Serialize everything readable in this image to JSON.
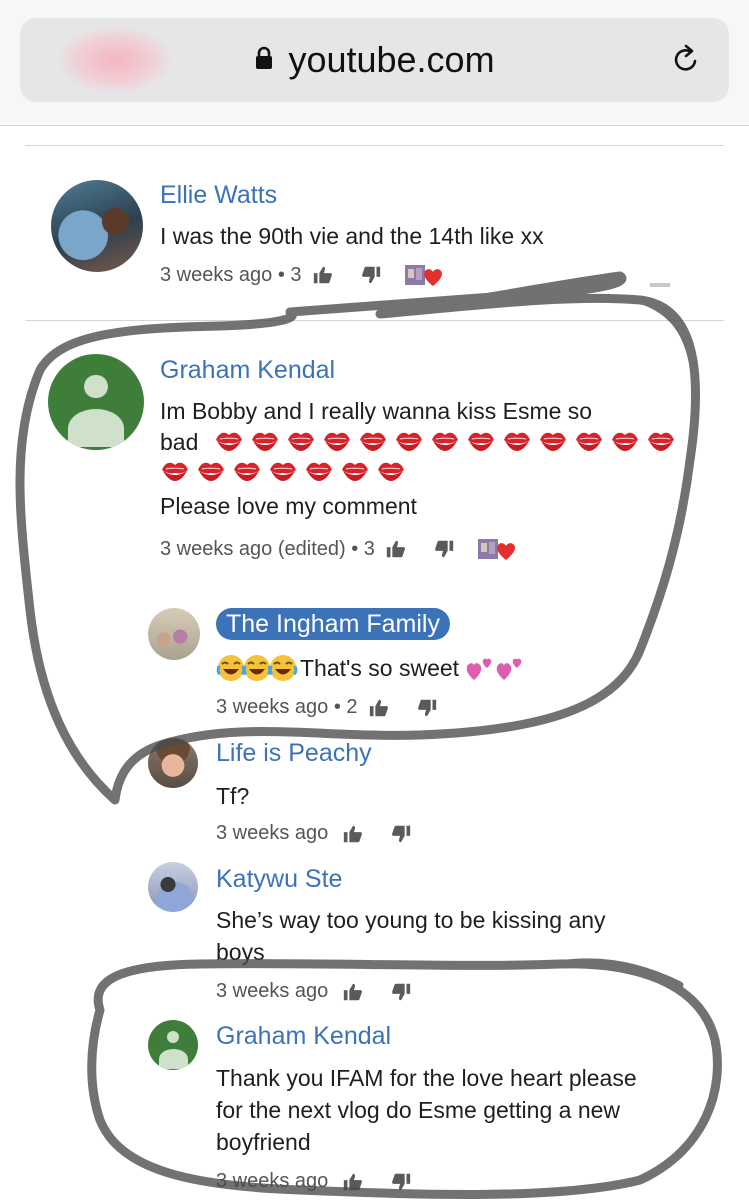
{
  "browser": {
    "url": "youtube.com"
  },
  "colors": {
    "link_blue": "#3b72b8",
    "default_avatar_green": "#3f7d3a",
    "heart_red": "#e3302f",
    "kiss_red": "#d8232a",
    "pink_hearts": "#e05cb0"
  },
  "comments": [
    {
      "author": "Ellie Watts",
      "text": "I was the 90th vie and the 14th like xx",
      "time": "3 weeks ago",
      "likes": "3",
      "creator_heart": true
    },
    {
      "author": "Graham Kendal",
      "text_line1": "Im Bobby and I really wanna kiss Esme so",
      "text_line2": "bad",
      "emoji": "kiss-mark",
      "text_line4": "Please love my comment",
      "time": "3 weeks ago (edited)",
      "likes": "3",
      "creator_heart": true,
      "replies": [
        {
          "author": "The Ingham Family",
          "text": "That's so sweet",
          "emoji_prefix": "tears-of-joy x3",
          "emoji_suffix": "two-hearts x2",
          "time": "3 weeks ago",
          "likes": "2"
        },
        {
          "author": "Life is Peachy",
          "text": "Tf?",
          "time": "3 weeks ago"
        },
        {
          "author": "Katywu Ste",
          "text_line1": "She’s way too young to be kissing any",
          "text_line2": "boys",
          "time": "3 weeks ago"
        },
        {
          "author": "Graham Kendal",
          "text_line1": "Thank you IFAM for the love heart please",
          "text_line2": "for the next vlog do Esme getting a new",
          "text_line3": "boyfriend",
          "time": "3 weeks ago"
        }
      ]
    }
  ]
}
